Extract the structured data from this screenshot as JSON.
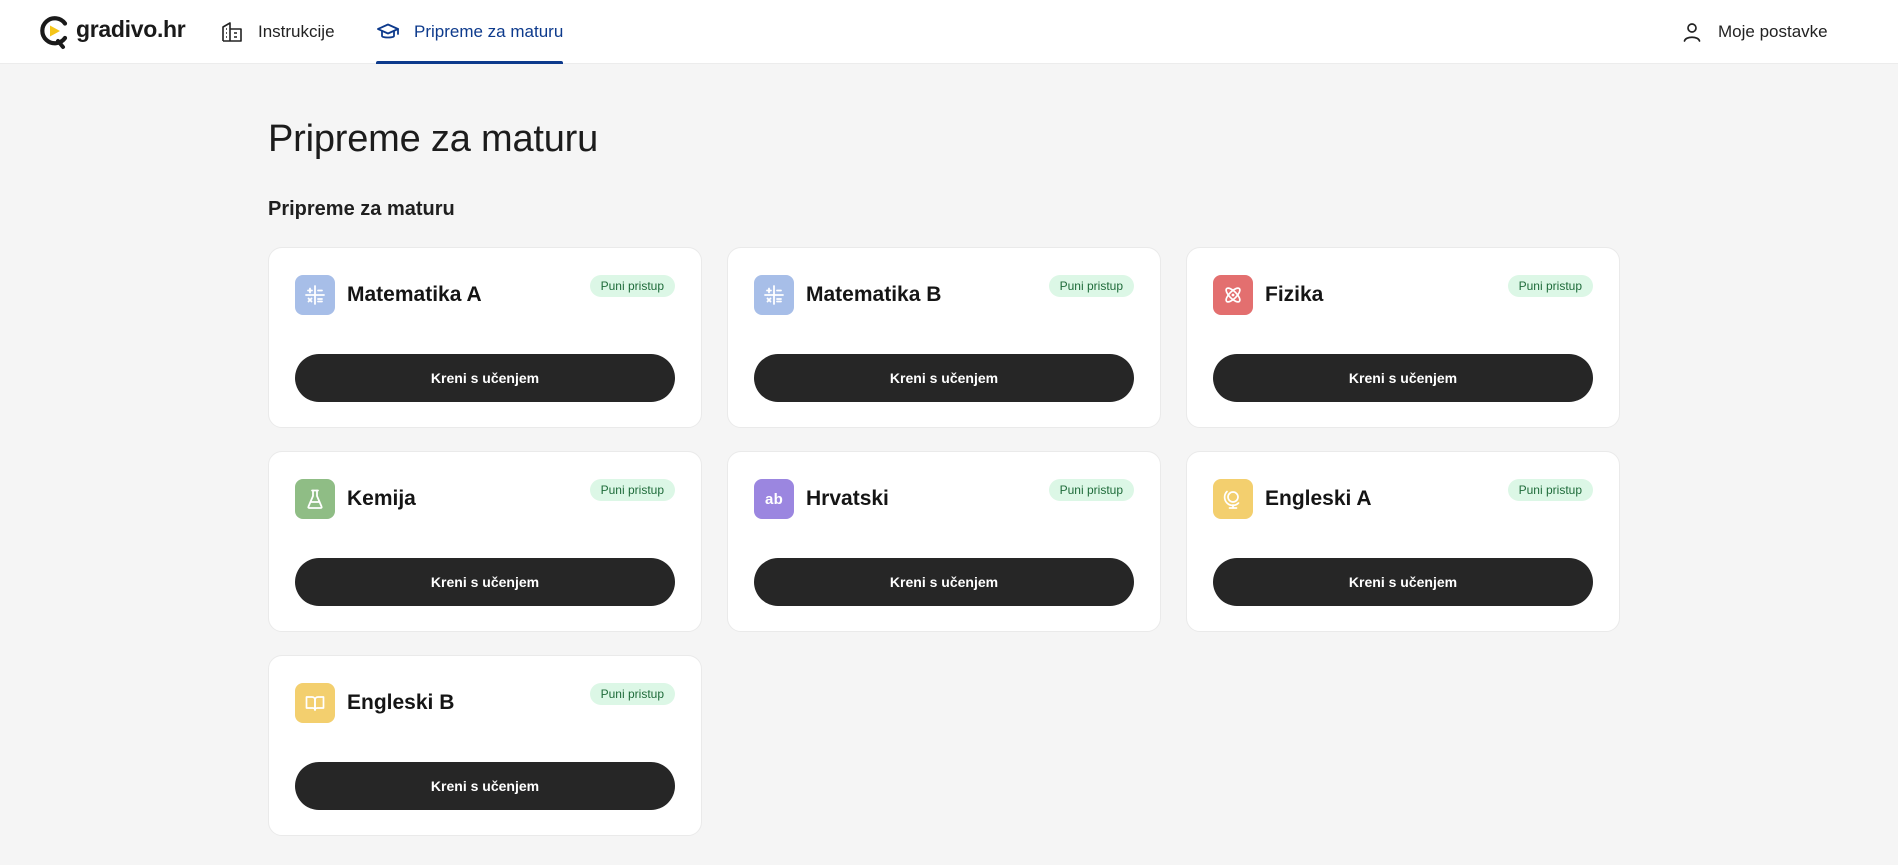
{
  "brand": {
    "name": "gradivo.hr",
    "accent": "#f5c518"
  },
  "nav": {
    "instrukcije": "Instrukcije",
    "matura": "Pripreme za maturu",
    "settings": "Moje postavke",
    "active_color": "#0d3a8c"
  },
  "page": {
    "title": "Pripreme za maturu",
    "section": "Pripreme za maturu"
  },
  "subjects": [
    {
      "name": "Matematika A",
      "badge": "Puni pristup",
      "button": "Kreni s učenjem",
      "icon": "math-icon",
      "color": "#a7bee8"
    },
    {
      "name": "Matematika B",
      "badge": "Puni pristup",
      "button": "Kreni s učenjem",
      "icon": "math-icon",
      "color": "#a7bee8"
    },
    {
      "name": "Fizika",
      "badge": "Puni pristup",
      "button": "Kreni s učenjem",
      "icon": "atom-icon",
      "color": "#e36f6f"
    },
    {
      "name": "Kemija",
      "badge": "Puni pristup",
      "button": "Kreni s učenjem",
      "icon": "flask-icon",
      "color": "#8fbd85"
    },
    {
      "name": "Hrvatski",
      "badge": "Puni pristup",
      "button": "Kreni s učenjem",
      "icon": "ab-icon",
      "icon_text": "ab",
      "color": "#9b86e0"
    },
    {
      "name": "Engleski A",
      "badge": "Puni pristup",
      "button": "Kreni s učenjem",
      "icon": "globe-icon",
      "color": "#f3cf6e"
    },
    {
      "name": "Engleski B",
      "badge": "Puni pristup",
      "button": "Kreni s učenjem",
      "icon": "book-icon",
      "color": "#f3cf6e"
    }
  ]
}
